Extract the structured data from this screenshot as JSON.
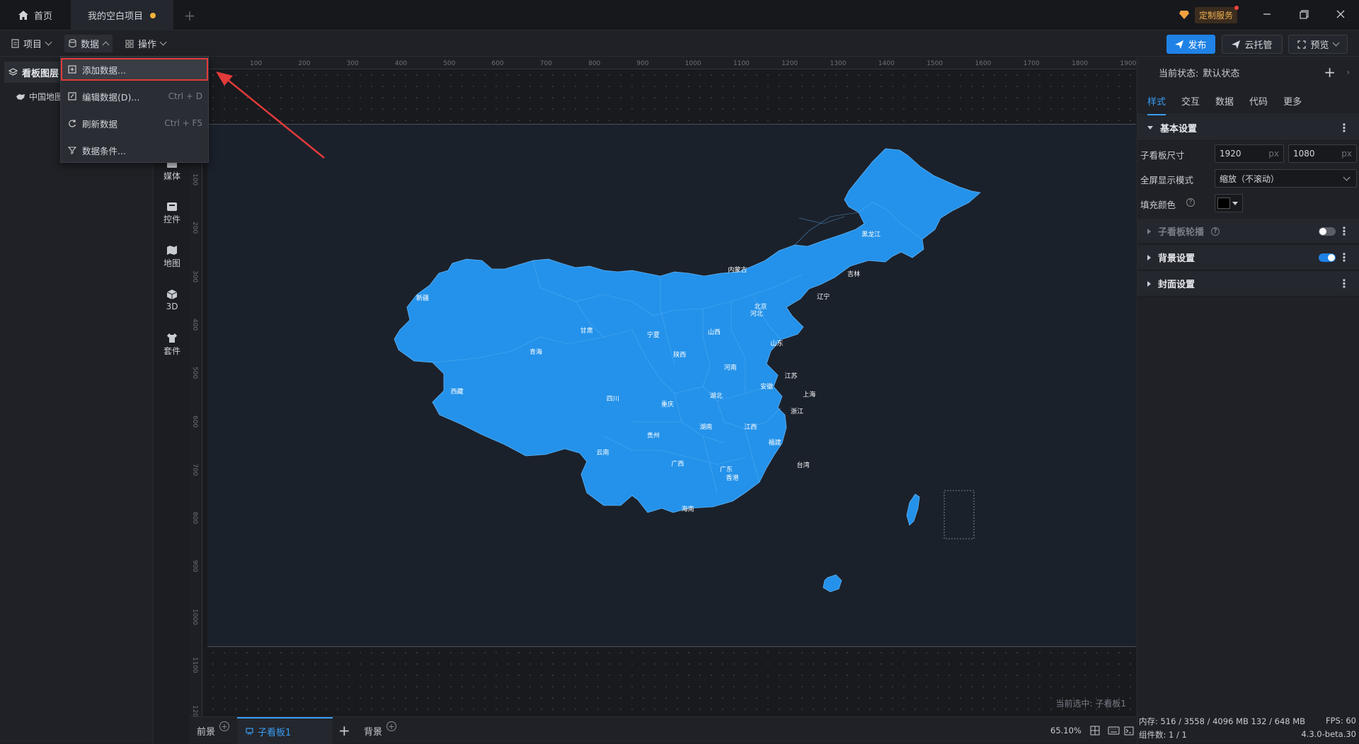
{
  "titlebar": {
    "home_tab": "首页",
    "project_tab": "我的空白项目",
    "vip_label": "定制服务"
  },
  "menubar": {
    "project": "项目",
    "data": "数据",
    "operate": "操作",
    "publish": "发布",
    "cloud": "云托管",
    "preview": "预览"
  },
  "dropdown": {
    "items": [
      {
        "label": "添加数据...",
        "shortcut": ""
      },
      {
        "label": "编辑数据(D)...",
        "shortcut": "Ctrl + D"
      },
      {
        "label": "刷新数据",
        "shortcut": "Ctrl + F5"
      },
      {
        "label": "数据条件..."
      }
    ]
  },
  "leftpanel": {
    "title": "看板图层",
    "layer_item": "中国地图",
    "rail": [
      {
        "label": "媒体",
        "icon": "media-icon"
      },
      {
        "label": "控件",
        "icon": "widget-icon"
      },
      {
        "label": "地图",
        "icon": "map-icon"
      },
      {
        "label": "3D",
        "icon": "cube-icon"
      },
      {
        "label": "套件",
        "icon": "kit-icon"
      }
    ]
  },
  "ruler": {
    "top": [
      "100",
      "200",
      "300",
      "400",
      "500",
      "600",
      "700",
      "800",
      "900",
      "1000",
      "1100",
      "1200",
      "1300",
      "1400",
      "1500",
      "1600",
      "1700",
      "1800",
      "1900"
    ],
    "left": [
      "100",
      "200",
      "300",
      "400",
      "500",
      "600",
      "700",
      "800",
      "900",
      "1000",
      "1100",
      "1200"
    ]
  },
  "map": {
    "provinces": [
      "新疆",
      "西藏",
      "青海",
      "甘肃",
      "内蒙古",
      "黑龙江",
      "吉林",
      "辽宁",
      "北京",
      "河北",
      "山西",
      "山东",
      "宁夏",
      "陕西",
      "河南",
      "江苏",
      "安徽",
      "上海",
      "湖北",
      "四川",
      "重庆",
      "浙江",
      "湖南",
      "江西",
      "贵州",
      "福建",
      "云南",
      "广西",
      "广东",
      "香港",
      "台湾",
      "海南"
    ],
    "fill_color": "#2492ea",
    "background": "#1b212b"
  },
  "canvas": {
    "current_selection": "当前选中: 子看板1"
  },
  "bottombar": {
    "foreground": "前景",
    "board": "子看板1",
    "background": "背景",
    "zoom": "65.10%"
  },
  "rightpanel": {
    "state_label": "当前状态:",
    "state_value": "默认状态",
    "tabs": [
      "样式",
      "交互",
      "数据",
      "代码",
      "更多"
    ],
    "sections": {
      "basic": "基本设置",
      "carousel": "子看板轮播",
      "background": "背景设置",
      "cover": "封面设置"
    },
    "fields": {
      "size_label": "子看板尺寸",
      "width": "1920",
      "height": "1080",
      "unit": "px",
      "fullscreen_label": "全屏显示模式",
      "fullscreen_value": "缩放（不滚动）",
      "fill_label": "填充颜色"
    }
  },
  "statusfooter": {
    "memory": "内存:  516 / 3558 / 4096 MB  132 / 648 MB",
    "fps": "FPS:  60",
    "components": "组件数: 1 / 1",
    "version": "4.3.0-beta.30"
  },
  "colors": {
    "accent": "#1f82e6",
    "highlight_border": "#e33a3a",
    "arrow": "#e33a3a"
  }
}
